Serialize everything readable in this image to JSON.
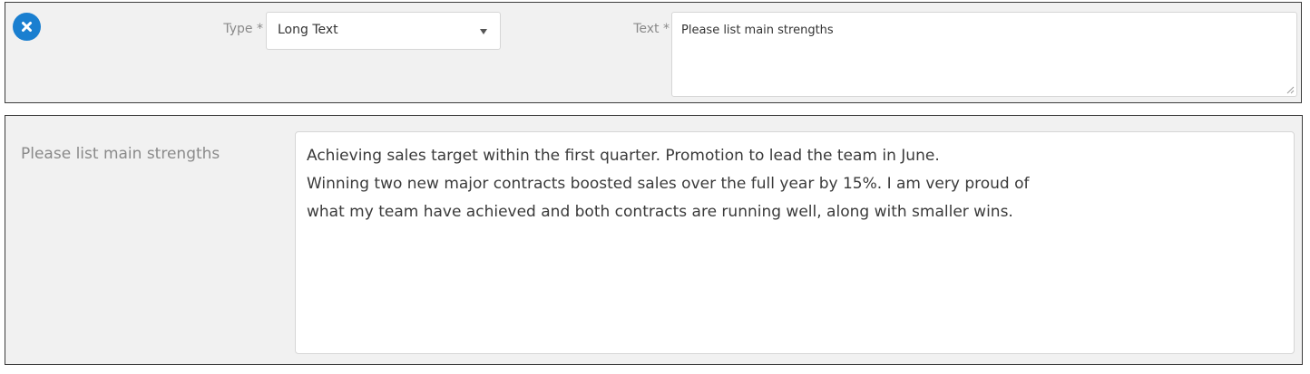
{
  "editor": {
    "remove_icon": "close-icon",
    "accent_color": "#1a7fd0",
    "type_label": "Type *",
    "type_value": "Long Text",
    "text_label": "Text *",
    "text_value": "Please list main strengths"
  },
  "preview": {
    "question_label": "Please list main strengths",
    "answer_lines": [
      "Achieving sales target within the first quarter. Promotion to lead the team in June.",
      "Winning two new major contracts boosted sales over the full year by 15%. I am very proud of",
      "what my team have achieved and both contracts are running well, along with smaller wins."
    ]
  }
}
